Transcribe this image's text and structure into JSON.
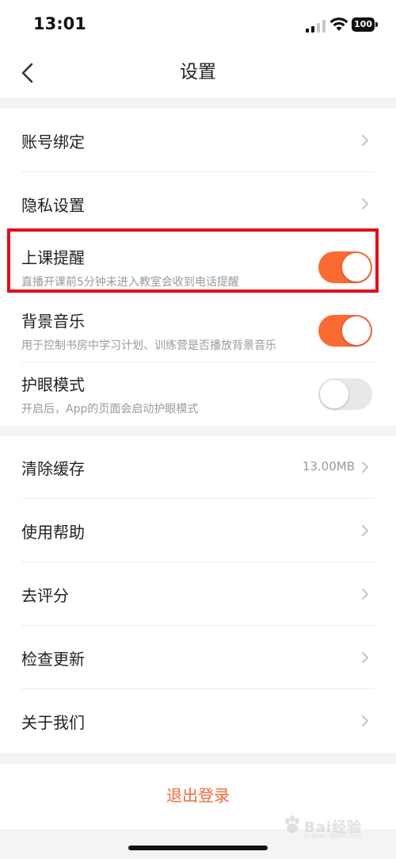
{
  "status_bar": {
    "time": "13:01",
    "battery": "100"
  },
  "nav": {
    "title": "设置"
  },
  "group1": [
    {
      "label": "账号绑定"
    },
    {
      "label": "隐私设置"
    }
  ],
  "toggles": [
    {
      "label": "上课提醒",
      "sub": "直播开课前5分钟未进入教室会收到电话提醒",
      "on": true
    },
    {
      "label": "背景音乐",
      "sub": "用于控制书房中学习计划、训练营是否播放背景音乐",
      "on": true
    },
    {
      "label": "护眼模式",
      "sub": "开启后，App的页面会启动护眼模式",
      "on": false
    }
  ],
  "group3": [
    {
      "label": "清除缓存",
      "value": "13.00MB"
    },
    {
      "label": "使用帮助"
    },
    {
      "label": "去评分"
    },
    {
      "label": "检查更新"
    },
    {
      "label": "关于我们"
    }
  ],
  "logout": {
    "label": "退出登录"
  },
  "watermark": {
    "text": "Bai经验",
    "sub": "jingyan.baidu.com"
  },
  "colors": {
    "accent": "#fa6a33",
    "logout_text": "#f06a35",
    "highlight": "#e20e1b"
  }
}
